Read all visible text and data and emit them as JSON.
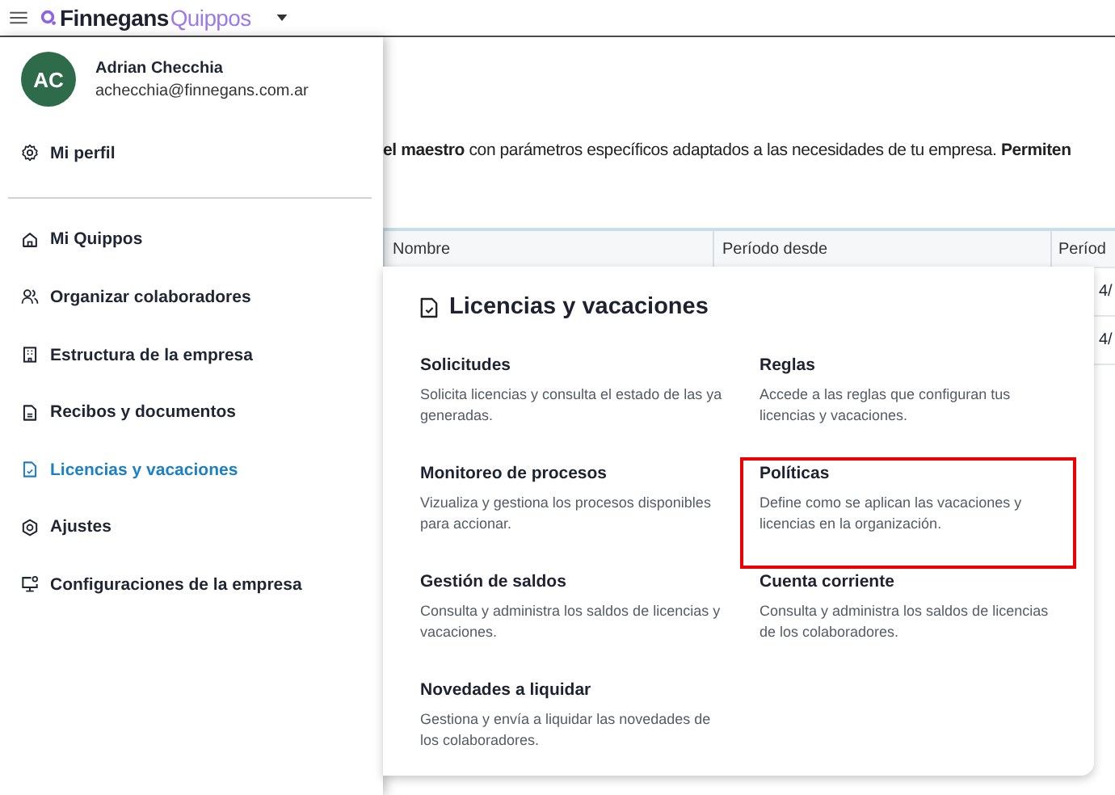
{
  "topbar": {
    "brand_primary": "Finnegans",
    "brand_secondary": "Quippos"
  },
  "page": {
    "intro": "**el maestro** con parámetros específicos adaptados a las necesidades de tu empresa. **Permiten**",
    "table": {
      "columns": [
        "Nombre",
        "Período desde",
        "Períod"
      ],
      "rows": [
        [
          "",
          "",
          "4/"
        ],
        [
          "",
          "",
          "4/"
        ]
      ]
    }
  },
  "sidebar": {
    "user": {
      "initials": "AC",
      "name": "Adrian Checchia",
      "email": "achecchia@finnegans.com.ar"
    },
    "profile_link": {
      "label": "Mi perfil"
    },
    "items": [
      {
        "label": "Mi Quippos",
        "selected": false
      },
      {
        "label": "Organizar colaboradores",
        "selected": false
      },
      {
        "label": "Estructura de la empresa",
        "selected": false
      },
      {
        "label": "Recibos y documentos",
        "selected": false
      },
      {
        "label": "Licencias y vacaciones",
        "selected": true
      },
      {
        "label": "Ajustes",
        "selected": false
      },
      {
        "label": "Configuraciones de la empresa",
        "selected": false
      }
    ]
  },
  "menu_card": {
    "title": "Licencias y vacaciones",
    "items": [
      {
        "title": "Solicitudes",
        "description": "Solicita licencias y consulta el estado de las ya generadas.",
        "highlighted": false
      },
      {
        "title": "Reglas",
        "description": "Accede a las reglas que configuran tus licencias y vacaciones.",
        "highlighted": false
      },
      {
        "title": "Monitoreo de procesos",
        "description": "Vizualiza y gestiona los procesos disponibles para accionar.",
        "highlighted": false
      },
      {
        "title": "Políticas",
        "description": "Define como se aplican las vacaciones y licencias en la organización.",
        "highlighted": true
      },
      {
        "title": "Gestión de saldos",
        "description": "Consulta y administra los saldos de licencias y vacaciones.",
        "highlighted": false
      },
      {
        "title": "Cuenta corriente",
        "description": "Consulta y administra los saldos de licencias de los colaboradores.",
        "highlighted": false
      },
      {
        "title": "Novedades a liquidar",
        "description": "Gestiona y envía a liquidar las novedades de los colaboradores.",
        "highlighted": false
      }
    ]
  }
}
